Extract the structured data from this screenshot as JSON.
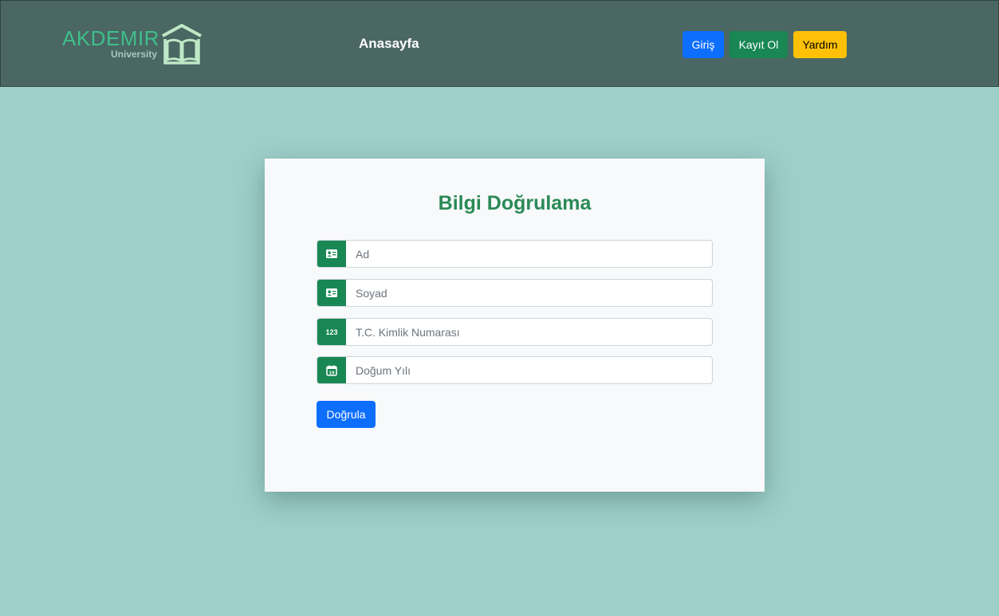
{
  "header": {
    "logo_text": "AKDEMIR",
    "logo_subtext": "University",
    "nav_home": "Anasayfa",
    "login_label": "Giriş",
    "register_label": "Kayıt Ol",
    "help_label": "Yardım"
  },
  "form": {
    "title": "Bilgi Doğrulama",
    "fields": [
      {
        "placeholder": "Ad",
        "value": "",
        "icon": "id-card-icon"
      },
      {
        "placeholder": "Soyad",
        "value": "",
        "icon": "id-card-icon"
      },
      {
        "placeholder": "T.C. Kimlik Numarası",
        "value": "",
        "icon": "numbers-icon",
        "icon_text": "123"
      },
      {
        "placeholder": "Doğum Yılı",
        "value": "",
        "icon": "calendar-icon",
        "icon_text": "19"
      }
    ],
    "submit_label": "Doğrula"
  },
  "colors": {
    "background": "#9ecfc8",
    "navbar": "#4a6763",
    "primary": "#0d6efd",
    "success": "#198754",
    "warning": "#ffc107",
    "title": "#2a8a57"
  }
}
